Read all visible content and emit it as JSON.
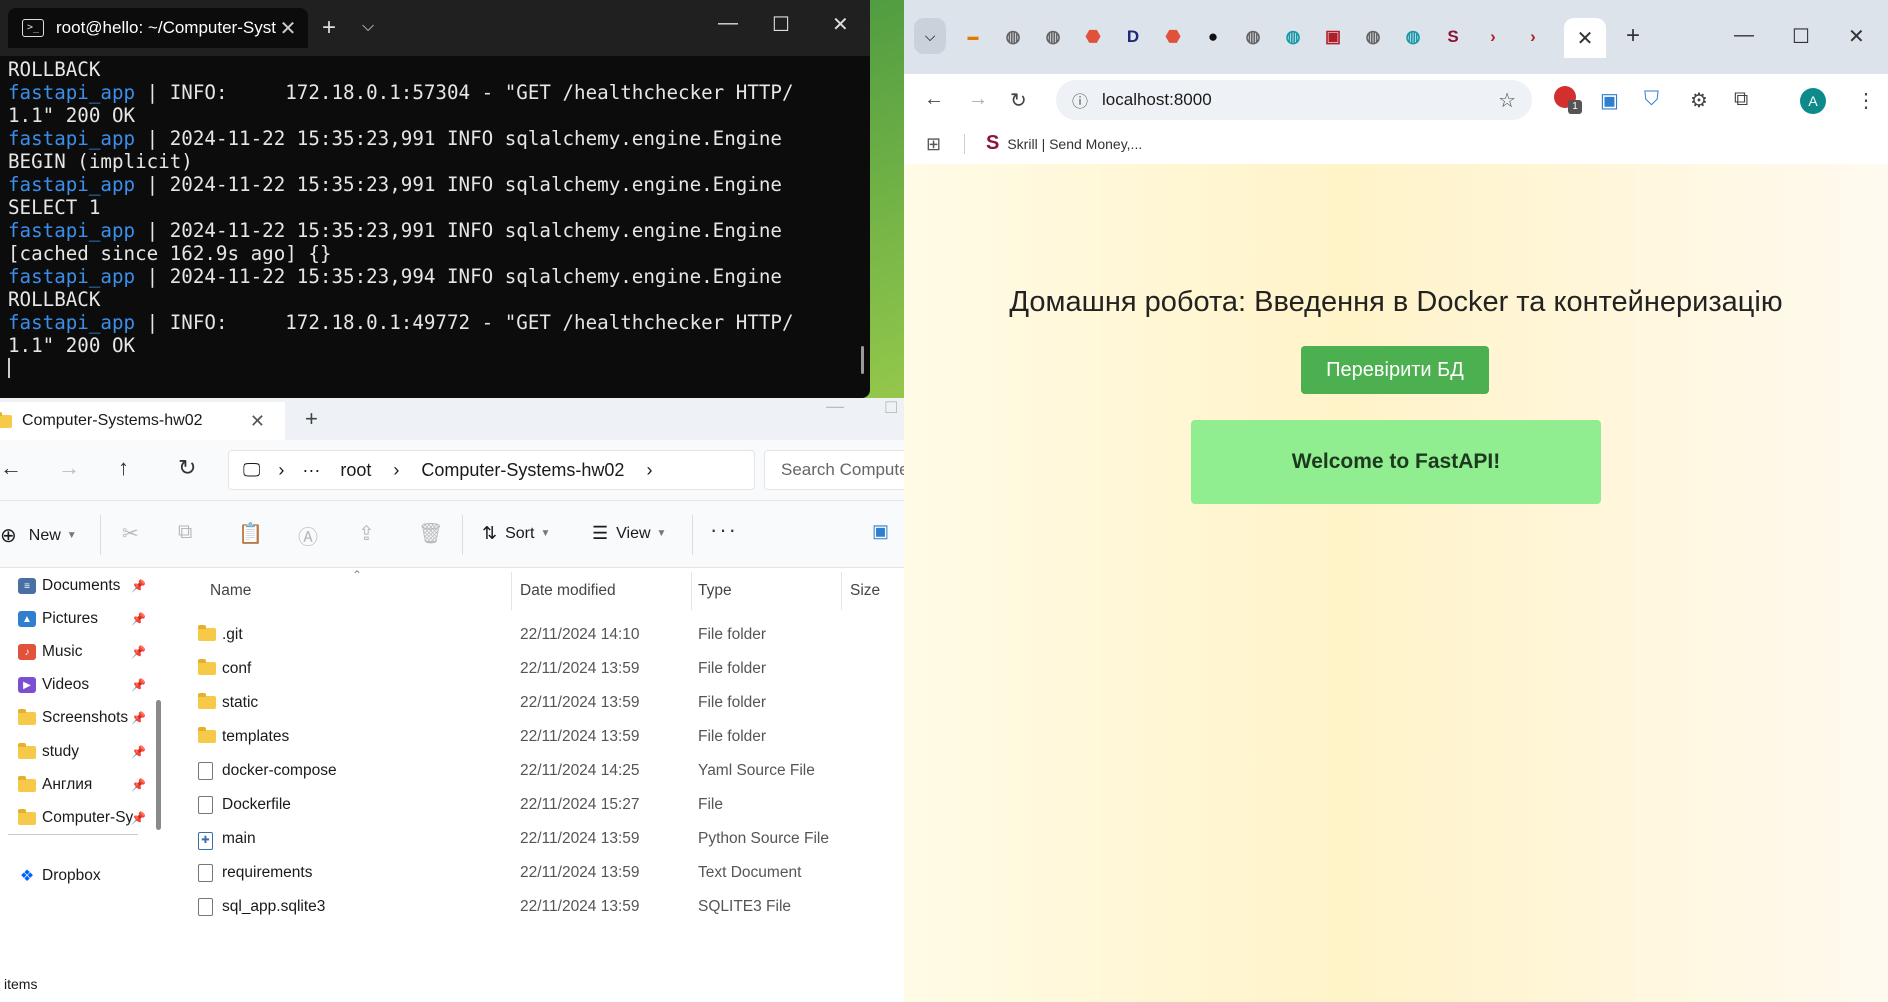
{
  "terminal": {
    "tab_title": "root@hello: ~/Computer-Syst",
    "lines": [
      {
        "prefix": "",
        "text": "ROLLBACK"
      },
      {
        "prefix": "fastapi_app",
        "text": " | INFO:     172.18.0.1:57304 - \"GET /healthchecker HTTP/"
      },
      {
        "prefix": "",
        "text": "1.1\" 200 OK"
      },
      {
        "prefix": "fastapi_app",
        "text": " | 2024-11-22 15:35:23,991 INFO sqlalchemy.engine.Engine"
      },
      {
        "prefix": "",
        "text": "BEGIN (implicit)"
      },
      {
        "prefix": "fastapi_app",
        "text": " | 2024-11-22 15:35:23,991 INFO sqlalchemy.engine.Engine"
      },
      {
        "prefix": "",
        "text": "SELECT 1"
      },
      {
        "prefix": "fastapi_app",
        "text": " | 2024-11-22 15:35:23,991 INFO sqlalchemy.engine.Engine"
      },
      {
        "prefix": "",
        "text": "[cached since 162.9s ago] {}"
      },
      {
        "prefix": "fastapi_app",
        "text": " | 2024-11-22 15:35:23,994 INFO sqlalchemy.engine.Engine"
      },
      {
        "prefix": "",
        "text": "ROLLBACK"
      },
      {
        "prefix": "fastapi_app",
        "text": " | INFO:     172.18.0.1:49772 - \"GET /healthchecker HTTP/"
      },
      {
        "prefix": "",
        "text": "1.1\" 200 OK"
      }
    ]
  },
  "explorer": {
    "tab_title": "Computer-Systems-hw02",
    "breadcrumb": [
      "root",
      "Computer-Systems-hw02"
    ],
    "search_placeholder": "Search Compute",
    "commands": {
      "new": "New",
      "sort": "Sort",
      "view": "View"
    },
    "sidebar": [
      {
        "label": "Documents",
        "icon": "documents-icon",
        "color": "#4a6fa5"
      },
      {
        "label": "Pictures",
        "icon": "pictures-icon",
        "color": "#2f7fd0"
      },
      {
        "label": "Music",
        "icon": "music-icon",
        "color": "#e0523a"
      },
      {
        "label": "Videos",
        "icon": "videos-icon",
        "color": "#7a4fd0"
      },
      {
        "label": "Screenshots",
        "icon": "folder-icon",
        "color": "#f7c948"
      },
      {
        "label": "study",
        "icon": "folder-icon",
        "color": "#f7c948"
      },
      {
        "label": "Англия",
        "icon": "folder-icon",
        "color": "#f7c948"
      },
      {
        "label": "Computer-Sy",
        "icon": "folder-icon",
        "color": "#f7c948"
      }
    ],
    "dropbox": "Dropbox",
    "columns": {
      "name": "Name",
      "date": "Date modified",
      "type": "Type",
      "size": "Size"
    },
    "files": [
      {
        "name": ".git",
        "date": "22/11/2024 14:10",
        "type": "File folder",
        "kind": "folder"
      },
      {
        "name": "conf",
        "date": "22/11/2024 13:59",
        "type": "File folder",
        "kind": "folder"
      },
      {
        "name": "static",
        "date": "22/11/2024 13:59",
        "type": "File folder",
        "kind": "folder"
      },
      {
        "name": "templates",
        "date": "22/11/2024 13:59",
        "type": "File folder",
        "kind": "folder"
      },
      {
        "name": "docker-compose",
        "date": "22/11/2024 14:25",
        "type": "Yaml Source File",
        "kind": "file"
      },
      {
        "name": "Dockerfile",
        "date": "22/11/2024 15:27",
        "type": "File",
        "kind": "file"
      },
      {
        "name": "main",
        "date": "22/11/2024 13:59",
        "type": "Python Source File",
        "kind": "python"
      },
      {
        "name": "requirements",
        "date": "22/11/2024 13:59",
        "type": "Text Document",
        "kind": "file"
      },
      {
        "name": "sql_app.sqlite3",
        "date": "22/11/2024 13:59",
        "type": "SQLITE3 File",
        "kind": "file"
      }
    ],
    "status": "items"
  },
  "browser": {
    "url": "localhost:8000",
    "bookmark": "Skrill | Send Money,...",
    "profile_initial": "A",
    "extension_badge": "1",
    "page": {
      "heading": "Домашня робота: Введення в Docker та контейнеризацію",
      "check_db_button": "Перевірити БД",
      "welcome": "Welcome to FastAPI!"
    },
    "colors": {
      "button": "#4caf50",
      "welcome_bg": "#90ee90"
    }
  }
}
